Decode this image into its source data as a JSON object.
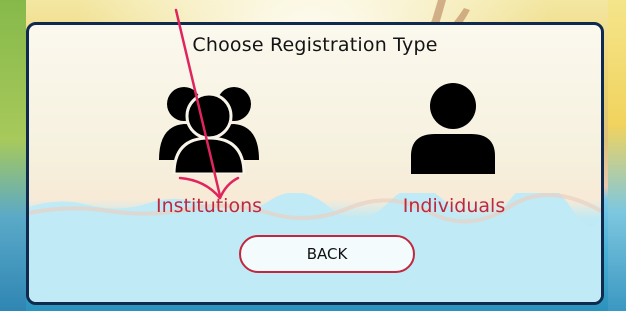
{
  "dialog": {
    "title": "Choose Registration Type",
    "options": [
      {
        "label": "Institutions",
        "icon": "group-icon"
      },
      {
        "label": "Individuals",
        "icon": "person-icon"
      }
    ],
    "back_label": "BACK"
  },
  "colors": {
    "label_red": "#c0283e",
    "panel_border": "#102a4d",
    "icon_black": "#000000",
    "annotation_pink": "#e0245e"
  }
}
